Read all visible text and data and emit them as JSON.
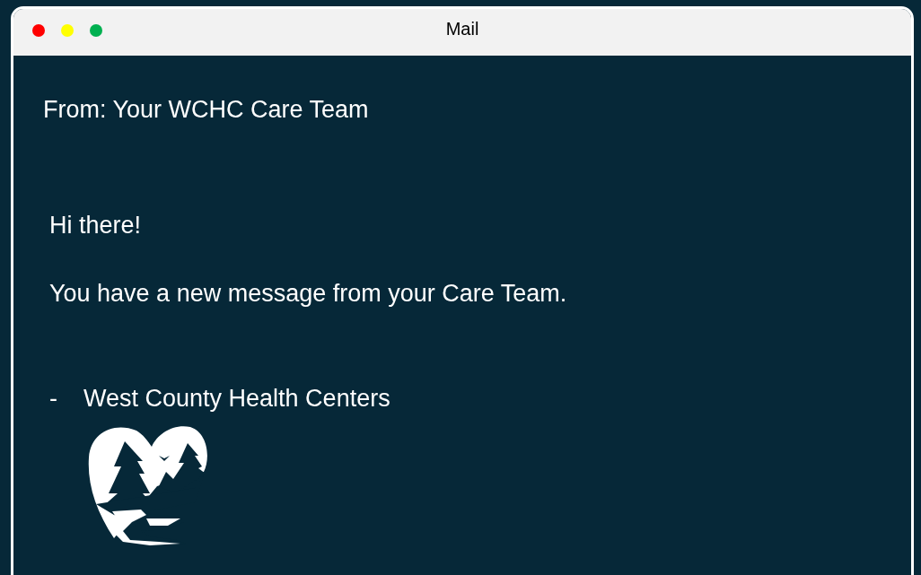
{
  "window": {
    "title": "Mail"
  },
  "email": {
    "from": "From: Your WCHC Care Team",
    "greeting": "Hi there!",
    "message": "You have a new message from your Care Team.",
    "signature_dash": "-",
    "signature": "West County Health Centers"
  }
}
